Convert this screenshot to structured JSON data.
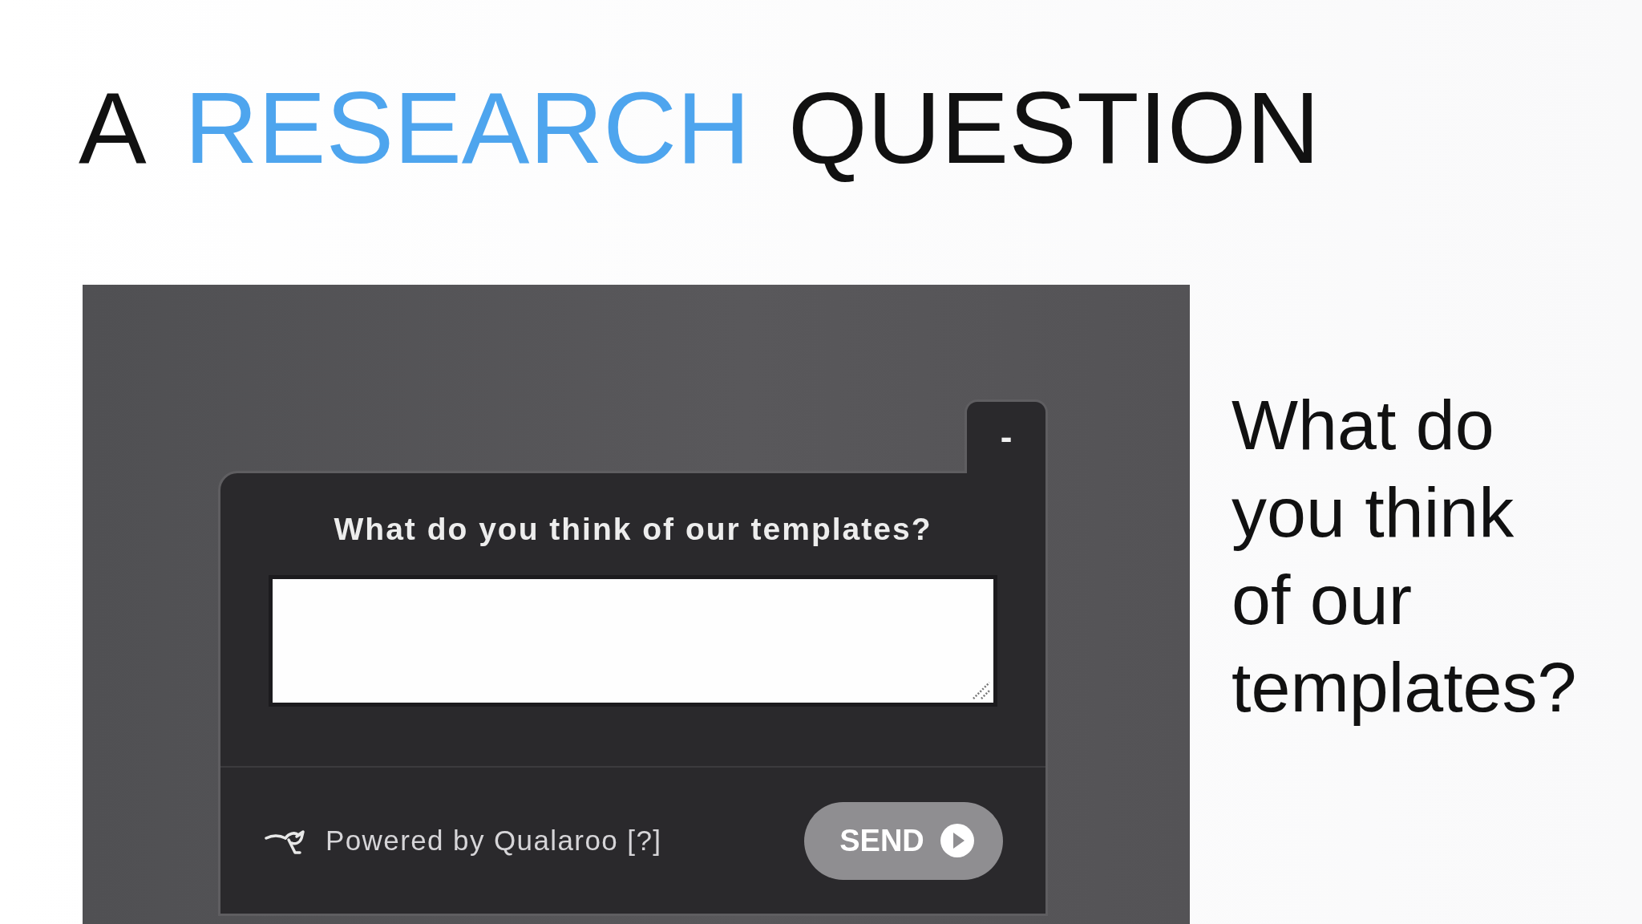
{
  "slide": {
    "title": [
      {
        "text": "A",
        "highlight": false
      },
      {
        "text": "RESEARCH",
        "highlight": true
      },
      {
        "text": "QUESTION",
        "highlight": false
      }
    ],
    "screenshot": {
      "survey_widget": {
        "minimize_button": "-",
        "question": "What do you think of our templates?",
        "footer_text": "Powered by Qualaroo [?]",
        "send_button": "SEND"
      }
    },
    "side_text": "What do you think of our templates?"
  }
}
